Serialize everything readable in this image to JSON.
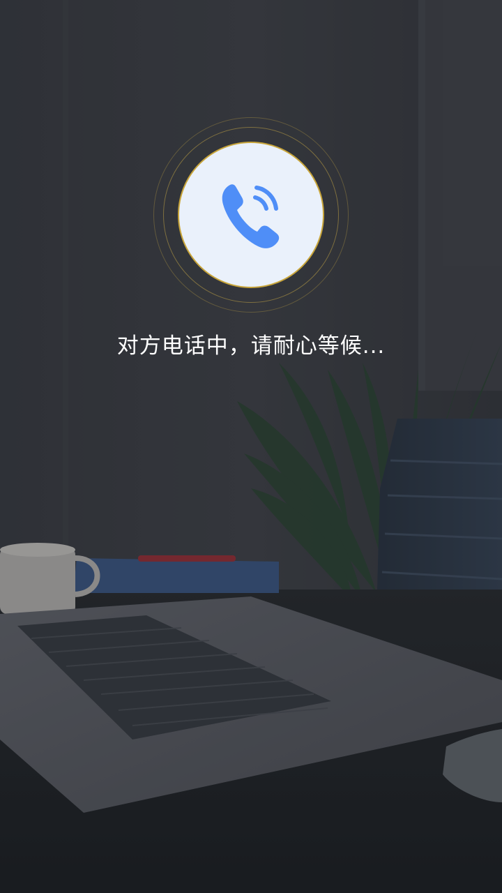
{
  "call": {
    "status_text": "对方电话中，请耐心等候..."
  },
  "icons": {
    "center": "phone-calling-icon"
  },
  "colors": {
    "icon_blue": "#4f8ef7",
    "avatar_bg": "#eaf1fb",
    "ring_gold": "#c8a53a",
    "text": "#ffffff"
  }
}
